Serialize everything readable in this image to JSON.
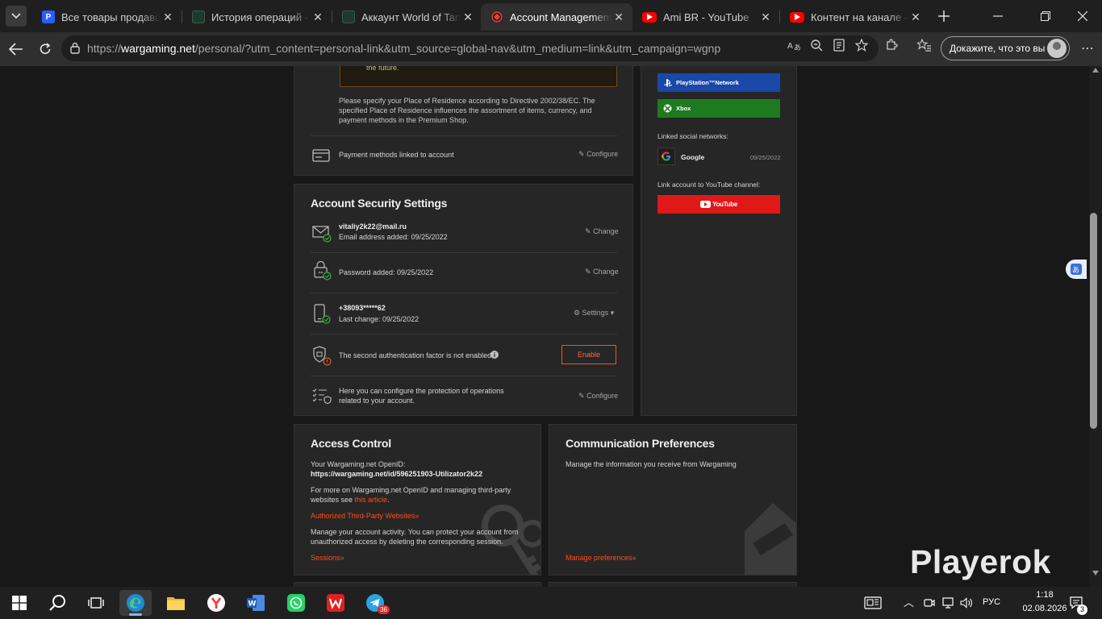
{
  "browser": {
    "tabs": [
      {
        "title": "Все товары продавца P",
        "favicon": "p-icon",
        "color": "#2b5cff"
      },
      {
        "title": "История операций - Lo",
        "favicon": "terminal-icon",
        "color": "#1e3a2e"
      },
      {
        "title": "Аккаунт World of Tanks",
        "favicon": "terminal-icon",
        "color": "#1e3a2e"
      },
      {
        "title": "Account Management | W",
        "favicon": "wargaming-icon",
        "color": "#cc2a2a"
      },
      {
        "title": "Ami BR - YouTube",
        "favicon": "youtube-icon",
        "color": "#ff0000"
      },
      {
        "title": "Контент на канале - Yo",
        "favicon": "youtube-icon",
        "color": "#ff0000"
      }
    ],
    "url_scheme": "https://",
    "url_host": "wargaming.net",
    "url_path": "/personal/?utm_content=personal-link&utm_source=global-nav&utm_medium=link&utm_campaign=wgnp",
    "profile_label": "Докажите, что это вы"
  },
  "residence": {
    "warning_text": "You will not be able to change this parameter in Account Management in the future.",
    "info_text": "Please specify your Place of Residence according to Directive 2002/38/EC. The specified Place of Residence influences the assortment of items, currency, and payment methods in the Premium Shop."
  },
  "payment": {
    "label": "Payment methods linked to account",
    "action": "Configure"
  },
  "security": {
    "title": "Account Security Settings",
    "email": "vitaliy2k22@mail.ru",
    "email_added": "Email address added: 09/25/2022",
    "email_action": "Change",
    "password_added": "Password added: 09/25/2022",
    "password_action": "Change",
    "phone": "+38093*****62",
    "phone_change": "Last change: 09/25/2022",
    "phone_action": "Settings",
    "twofa_text": "The second authentication factor is not enabled.",
    "twofa_action": "Enable",
    "operations_text": "Here you can configure the protection of operations related to your account.",
    "operations_action": "Configure"
  },
  "side": {
    "psn": "PlayStation™Network",
    "xbox": "Xbox",
    "social_label": "Linked social networks:",
    "google": "Google",
    "google_date": "09/25/2022",
    "youtube_label": "Link account to YouTube channel:",
    "youtube_btn": "YouTube"
  },
  "access": {
    "title": "Access Control",
    "openid_label": "Your Wargaming.net OpenID:",
    "openid_url": "https://wargaming.net/id/596251903-Utilizator2k22",
    "more_text": "For more on Wargaming.net OpenID and managing third-party websites see",
    "article_link": "this article",
    "authorized_link": "Authorized Third-Party Websites»",
    "activity_text": "Manage your account activity. You can protect your account from unauthorized access by deleting the corresponding session.",
    "sessions_link": "Sessions»"
  },
  "comm": {
    "title": "Communication Preferences",
    "text": "Manage the information you receive from Wargaming",
    "link": "Manage preferences»"
  },
  "watermark": "Playerok",
  "taskbar": {
    "lang": "РУС",
    "time": "1:18",
    "date": "02.08.2026",
    "telegram_badge": "36",
    "notif_count": "3"
  },
  "colors": {
    "accent_red": "#ff4d1a",
    "psn_blue": "#1a48a8",
    "xbox_green": "#1e7a1e",
    "youtube_red": "#e01818",
    "check_green": "#3ab03a",
    "warn_orange": "#e05a2a"
  }
}
